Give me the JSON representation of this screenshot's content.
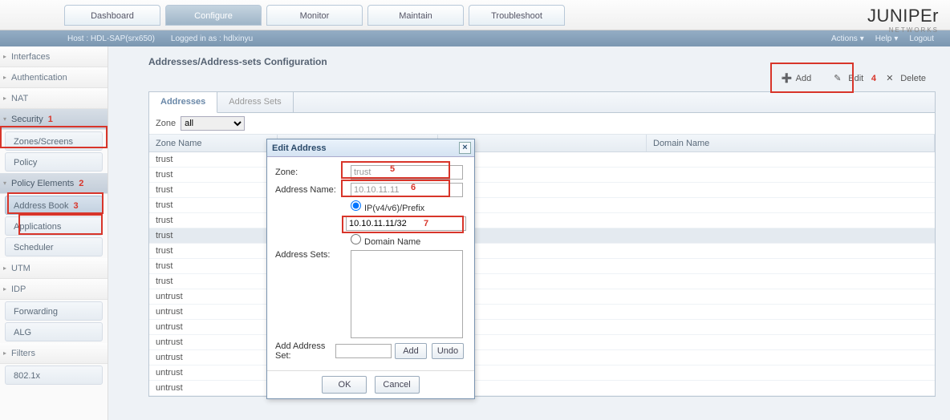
{
  "topTabs": [
    "Dashboard",
    "Configure",
    "Monitor",
    "Maintain",
    "Troubleshoot"
  ],
  "topActive": 1,
  "logo": {
    "big": "JUNIPEr",
    "small": "NETWORKS"
  },
  "subbar": {
    "host": "Host : HDL-SAP(srx650)",
    "login": "Logged in as : hdlxinyu",
    "actions": "Actions",
    "help": "Help",
    "logout": "Logout"
  },
  "sidebar": [
    {
      "t": "sec",
      "label": "Interfaces"
    },
    {
      "t": "sec",
      "label": "Authentication"
    },
    {
      "t": "sec",
      "label": "NAT"
    },
    {
      "t": "sec",
      "label": "Security",
      "sel": true,
      "open": true,
      "annot": "1"
    },
    {
      "t": "sub",
      "label": "Zones/Screens"
    },
    {
      "t": "sub",
      "label": "Policy"
    },
    {
      "t": "sec",
      "label": "Policy Elements",
      "sel": true,
      "open": true,
      "annot": "2"
    },
    {
      "t": "sub",
      "label": "Address Book",
      "sel": true,
      "annot": "3"
    },
    {
      "t": "sub",
      "label": "Applications"
    },
    {
      "t": "sub",
      "label": "Scheduler"
    },
    {
      "t": "sec",
      "label": "UTM"
    },
    {
      "t": "sec",
      "label": "IDP"
    },
    {
      "t": "sub",
      "label": "Forwarding"
    },
    {
      "t": "sub",
      "label": "ALG"
    },
    {
      "t": "sec",
      "label": "Filters"
    },
    {
      "t": "sub",
      "label": "802.1x"
    }
  ],
  "page": {
    "title": "Addresses/Address-sets Configuration"
  },
  "toolbar": {
    "add": "Add",
    "edit": "Edit",
    "delete": "Delete",
    "annot4": "4"
  },
  "panel": {
    "tabs": [
      "Addresses",
      "Address Sets"
    ],
    "activeTab": 0,
    "zoneLabel": "Zone",
    "zoneVal": "all",
    "columns": [
      "Zone Name",
      "",
      "",
      "Domain Name"
    ],
    "rows": [
      {
        "zone": "trust"
      },
      {
        "zone": "trust"
      },
      {
        "zone": "trust"
      },
      {
        "zone": "trust"
      },
      {
        "zone": "trust"
      },
      {
        "zone": "trust",
        "sel": true
      },
      {
        "zone": "trust"
      },
      {
        "zone": "trust"
      },
      {
        "zone": "trust"
      },
      {
        "zone": "untrust"
      },
      {
        "zone": "untrust"
      },
      {
        "zone": "untrust"
      },
      {
        "zone": "untrust"
      },
      {
        "zone": "untrust"
      },
      {
        "zone": "untrust"
      },
      {
        "zone": "untrust"
      }
    ]
  },
  "dialog": {
    "title": "Edit Address",
    "zoneLabel": "Zone:",
    "zoneVal": "trust",
    "nameLabel": "Address Name:",
    "nameVal": "10.10.11.11",
    "ipRadio": "IP(v4/v6)/Prefix",
    "ipVal": "10.10.11.11/32",
    "dnRadio": "Domain Name",
    "setsLabel": "Address Sets:",
    "addSetLabel": "Add Address Set:",
    "addBtn": "Add",
    "undoBtn": "Undo",
    "ok": "OK",
    "cancel": "Cancel"
  },
  "annots": {
    "a5": "5",
    "a6": "6",
    "a7": "7"
  }
}
